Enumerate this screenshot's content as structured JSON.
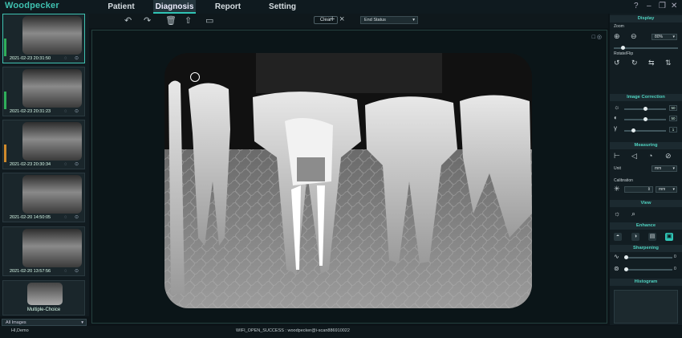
{
  "app": {
    "name": "Woodpecker"
  },
  "nav": {
    "tabs": [
      "Patient",
      "Diagnosis",
      "Report",
      "Setting"
    ],
    "active": "Diagnosis"
  },
  "window_controls": [
    "?",
    "–",
    "❐",
    "✕"
  ],
  "thumbnails": [
    {
      "timestamp": "2021-02-23 20:31:50",
      "selected": true,
      "indicator": "#2fae5a"
    },
    {
      "timestamp": "2021-02-23 20:31:23",
      "selected": false,
      "indicator": "#2fae5a"
    },
    {
      "timestamp": "2021-02-23 20:30:34",
      "selected": false,
      "indicator": "#d08a2c"
    },
    {
      "timestamp": "2021-02-20 14:50:05",
      "selected": false,
      "indicator": ""
    },
    {
      "timestamp": "2021-02-20 13:57:56",
      "selected": false,
      "indicator": ""
    }
  ],
  "multiple_choice": "Multiple-Choice",
  "image_filter": {
    "value": "All Images",
    "icon": "chevron-down"
  },
  "toolbar": {
    "icons": [
      "undo-icon",
      "redo-icon",
      "trash-icon",
      "export-icon",
      "comment-icon"
    ],
    "clear_label": "Clear",
    "status_value": "End Status",
    "add_label": "+",
    "close_label": "×"
  },
  "viewer": {
    "controls": [
      "□",
      "◎"
    ]
  },
  "sidebar": {
    "display": {
      "title": "Display",
      "zoom_label": "Zoom",
      "zoom_value": "80%",
      "zoom_level": 0.12,
      "rotate_label": "Rotate/Flip"
    },
    "image_correction": {
      "title": "Image Correction",
      "brightness": {
        "value": "50",
        "level": 0.5
      },
      "contrast": {
        "value": "50",
        "level": 0.5
      },
      "gamma": {
        "value": "1",
        "level": 0.2
      }
    },
    "measuring": {
      "title": "Measuring",
      "unit_label": "Unit",
      "unit_value": "mm",
      "calibration_label": "Calibration",
      "calibration_unit": "mm"
    },
    "view": {
      "title": "View"
    },
    "enhance": {
      "title": "Enhance",
      "active_color": "#2fc3b4"
    },
    "sharpening": {
      "title": "Sharpening",
      "first": {
        "value": "0",
        "level": 0
      },
      "second": {
        "value": "0",
        "level": 0
      }
    },
    "histogram": {
      "title": "Histogram"
    }
  },
  "statusbar": {
    "left": "HI,Demo",
    "message": "WIFI_OPEN_SUCCESS : woodpecker@i-scan886910022"
  },
  "colors": {
    "accent": "#2fc3b4",
    "brand": "#3fc1b0",
    "background": "#0c1418"
  }
}
